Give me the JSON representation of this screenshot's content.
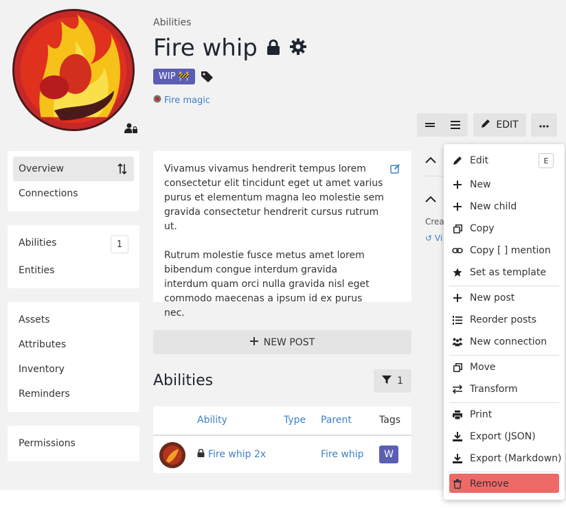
{
  "breadcrumb": "Abilities",
  "entity": {
    "name": "Fire whip",
    "wip_label": "WIP 🚧",
    "parent_link": "Fire magic"
  },
  "toolbar": {
    "edit_label": "EDIT"
  },
  "sidebar": {
    "groups": [
      [
        {
          "label": "Overview"
        },
        {
          "label": "Connections"
        }
      ],
      [
        {
          "label": "Abilities",
          "count": "1"
        },
        {
          "label": "Entities"
        }
      ],
      [
        {
          "label": "Assets"
        },
        {
          "label": "Attributes"
        },
        {
          "label": "Inventory"
        },
        {
          "label": "Reminders"
        }
      ],
      [
        {
          "label": "Permissions"
        }
      ]
    ]
  },
  "entry": {
    "paragraphs": [
      "Vivamus vivamus hendrerit tempus lorem consectetur elit tincidunt eget ut amet varius purus et elementum magna leo molestie sem gravida consectetur hendrerit cursus rutrum ut.",
      "Rutrum molestie fusce metus amet lorem bibendum congue interdum gravida interdum quam orci nulla gravida nisl eget commodo maecenas a ipsum id ex purus nec."
    ]
  },
  "new_post_label": "NEW POST",
  "abilities": {
    "heading": "Abilities",
    "filter_count": "1",
    "columns": {
      "ability": "Ability",
      "type": "Type",
      "parent": "Parent",
      "tags": "Tags"
    },
    "rows": [
      {
        "ability": "Fire whip 2x",
        "type": "",
        "parent": "Fire whip",
        "tag": "W"
      }
    ]
  },
  "right": {
    "created": "Crea",
    "history": "Vi"
  },
  "menu": {
    "items": [
      {
        "label": "Edit",
        "shortcut": "E",
        "icon": "pencil-icon"
      },
      {
        "label": "New",
        "icon": "plus-icon"
      },
      {
        "label": "New child",
        "icon": "plus-icon"
      },
      {
        "label": "Copy",
        "icon": "copy-icon"
      },
      {
        "label": "Copy [ ] mention",
        "icon": "link-icon"
      },
      {
        "label": "Set as template",
        "icon": "star-icon"
      },
      {
        "label": "New post",
        "icon": "plus-icon"
      },
      {
        "label": "Reorder posts",
        "icon": "list-ordered-icon"
      },
      {
        "label": "New connection",
        "icon": "people-icon"
      },
      {
        "label": "Move",
        "icon": "move-icon"
      },
      {
        "label": "Transform",
        "icon": "arrows-exchange-icon"
      },
      {
        "label": "Print",
        "icon": "print-icon"
      },
      {
        "label": "Export (JSON)",
        "icon": "download-icon"
      },
      {
        "label": "Export (Markdown)",
        "icon": "download-icon"
      },
      {
        "label": "Remove",
        "icon": "trash-icon"
      }
    ]
  },
  "colors": {
    "accent": "#3b82c4",
    "badge": "#5b5eb5",
    "danger": "#ee6a67"
  }
}
